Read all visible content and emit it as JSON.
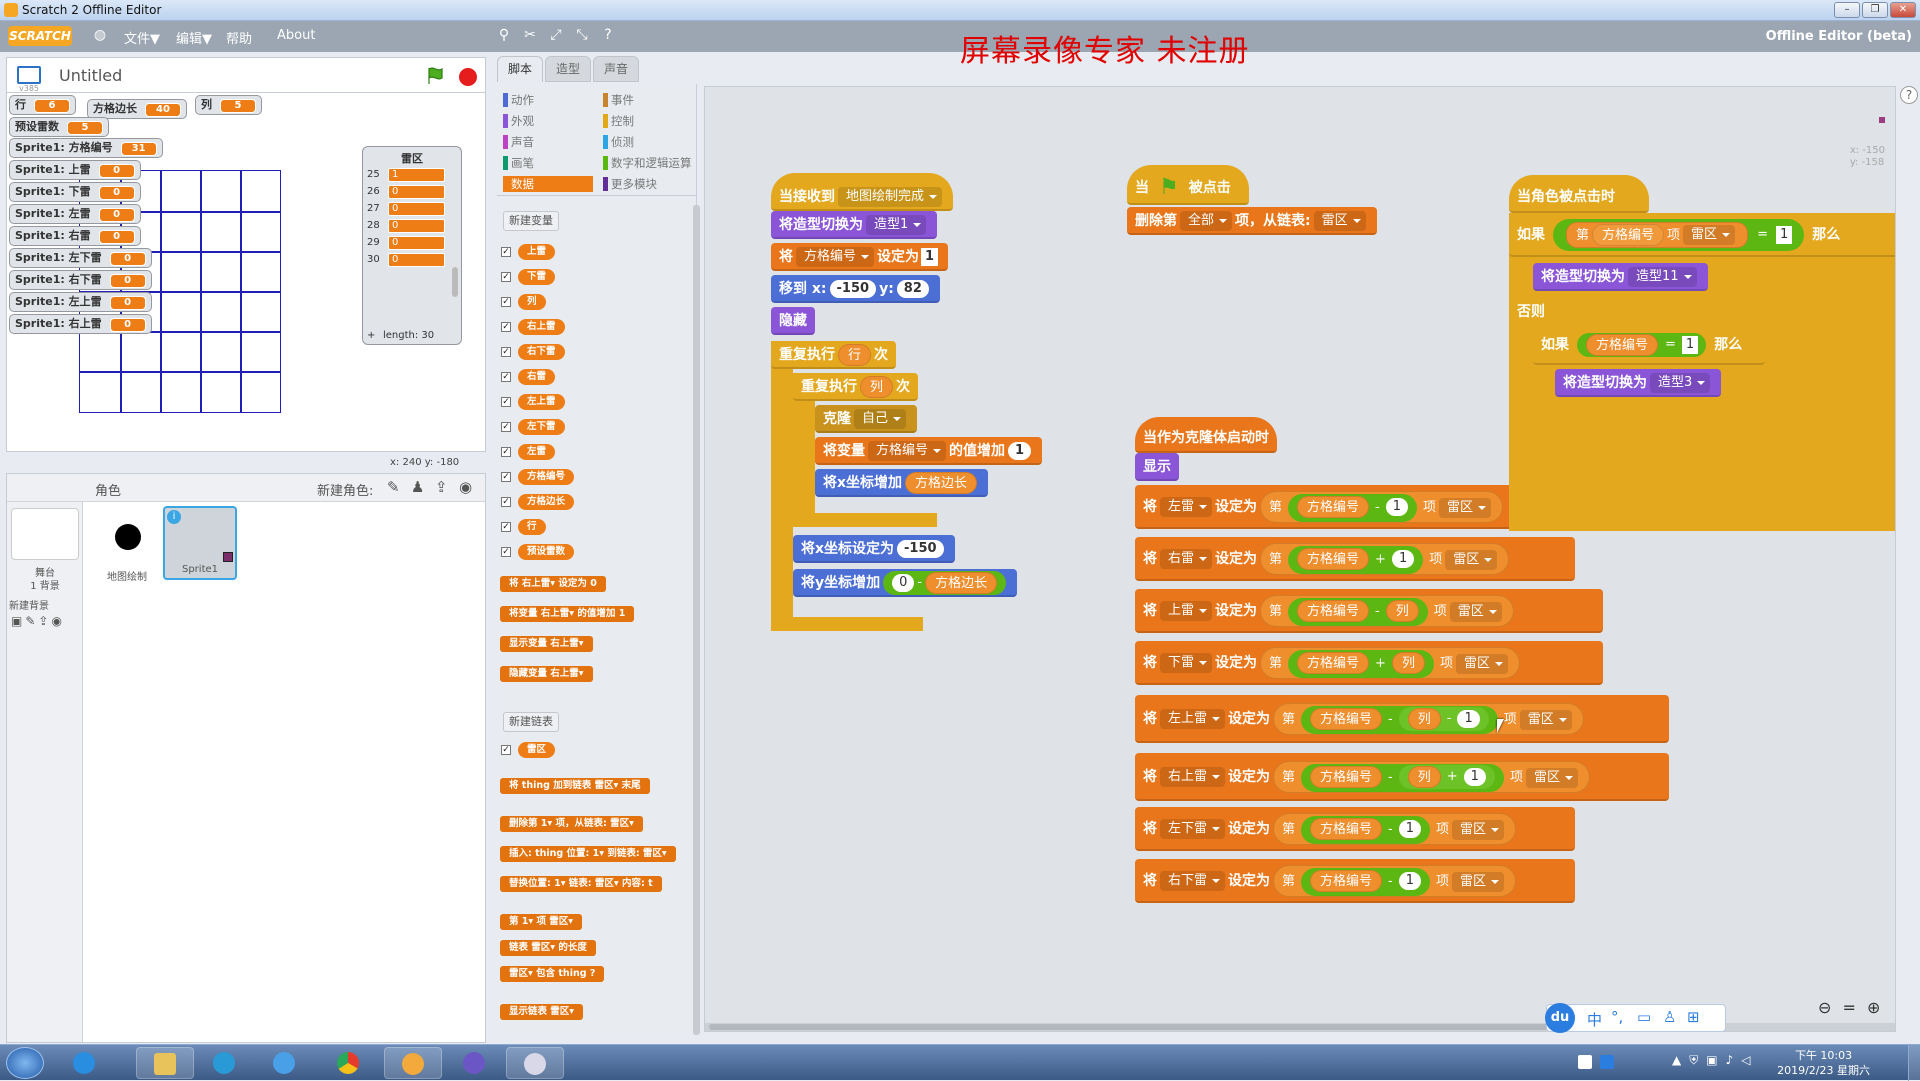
{
  "window": {
    "title": "Scratch 2 Offline Editor"
  },
  "menu": {
    "logo": "SCRATCH",
    "file": "文件▼",
    "edit": "编辑▼",
    "help": "帮助",
    "about": "About",
    "edition": "Offline Editor (beta)"
  },
  "watermark": "屏幕录像专家  未注册",
  "stage": {
    "project_title": "Untitled",
    "version": "v385",
    "coords": "x: 240   y: -180"
  },
  "monitors": [
    {
      "label": "行",
      "value": "6"
    },
    {
      "label": "方格边长",
      "value": "40"
    },
    {
      "label": "列",
      "value": "5"
    },
    {
      "label": "预设雷数",
      "value": "5"
    },
    {
      "label": "Sprite1: 方格编号",
      "value": "31"
    },
    {
      "label": "Sprite1: 上雷",
      "value": "0"
    },
    {
      "label": "Sprite1: 下雷",
      "value": "0"
    },
    {
      "label": "Sprite1: 左雷",
      "value": "0"
    },
    {
      "label": "Sprite1: 右雷",
      "value": "0"
    },
    {
      "label": "Sprite1: 左下雷",
      "value": "0"
    },
    {
      "label": "Sprite1: 右下雷",
      "value": "0"
    },
    {
      "label": "Sprite1: 左上雷",
      "value": "0"
    },
    {
      "label": "Sprite1: 右上雷",
      "value": "0"
    }
  ],
  "list_monitor": {
    "title": "雷区",
    "rows": [
      {
        "i": "25",
        "v": "1"
      },
      {
        "i": "26",
        "v": "0"
      },
      {
        "i": "27",
        "v": "0"
      },
      {
        "i": "28",
        "v": "0"
      },
      {
        "i": "29",
        "v": "0"
      },
      {
        "i": "30",
        "v": "0"
      }
    ],
    "length": "length: 30",
    "add": "+"
  },
  "sprites": {
    "header": "角色",
    "new_sprite": "新建角色:",
    "stage_label": "舞台",
    "stage_sub": "1 背景",
    "new_backdrop": "新建背景",
    "items": [
      {
        "name": "地图绘制"
      },
      {
        "name": "Sprite1"
      }
    ]
  },
  "tabs": [
    "脚本",
    "造型",
    "声音"
  ],
  "categories": {
    "left": [
      {
        "label": "动作",
        "color": "#4a6cd4"
      },
      {
        "label": "外观",
        "color": "#8a55d7"
      },
      {
        "label": "声音",
        "color": "#bb42c3"
      },
      {
        "label": "画笔",
        "color": "#0e9a6c"
      },
      {
        "label": "数据",
        "color": "#ee7d16"
      }
    ],
    "right": [
      {
        "label": "事件",
        "color": "#c88330"
      },
      {
        "label": "控制",
        "color": "#e1a91a"
      },
      {
        "label": "侦测",
        "color": "#2ca5e2"
      },
      {
        "label": "数字和逻辑运算",
        "color": "#5cb712"
      },
      {
        "label": "更多模块",
        "color": "#632d99"
      }
    ]
  },
  "palette": {
    "new_var": "新建变量",
    "new_list": "新建链表",
    "vars": [
      "上雷",
      "下雷",
      "列",
      "右上雷",
      "右下雷",
      "右雷",
      "左上雷",
      "左下雷",
      "左雷",
      "方格编号",
      "方格边长",
      "行",
      "预设雷数"
    ],
    "var_blocks": [
      "将 右上雷▾ 设定为 0",
      "将变量 右上雷▾ 的值增加 1",
      "显示变量 右上雷▾",
      "隐藏变量 右上雷▾"
    ],
    "list": "雷区",
    "list_blocks": [
      "将 thing 加到链表 雷区▾ 末尾",
      "删除第 1▾ 项，从链表: 雷区▾",
      "插入: thing 位置: 1▾ 到链表: 雷区▾",
      "替换位置: 1▾ 链表: 雷区▾ 内容: t",
      "第 1▾ 项 雷区▾",
      "链表 雷区▾ 的长度",
      "雷区▾ 包含 thing ?",
      "显示链表 雷区▾"
    ]
  },
  "scripts": {
    "s1": {
      "hat": "当接收到",
      "msg": "地图绘制完成",
      "switch": "将造型切换为",
      "costume": "造型1",
      "set": "将",
      "setvar": "方格编号",
      "setto": "设定为",
      "setval": "1",
      "goto": "移到 x:",
      "gx": "-150",
      "gy_l": "y:",
      "gy": "82",
      "hide": "隐藏",
      "rep1": "重复执行",
      "rep1v": "行",
      "rep_t": "次",
      "rep2v": "列",
      "clone": "克隆",
      "cloneof": "自己",
      "chg": "将变量",
      "chgvar": "方格编号",
      "chgby": "的值增加",
      "chgval": "1",
      "chx": "将x坐标增加",
      "chxv": "方格边长",
      "setx": "将x坐标设定为",
      "setxv": "-150",
      "chy": "将y坐标增加",
      "chyv0": "0",
      "minus": "-",
      "chyv": "方格边长"
    },
    "s2": {
      "hat_when": "当",
      "hat_clicked": "被点击",
      "del": "删除第",
      "delwhich": "全部",
      "delof": "项，从链表:",
      "dellist": "雷区"
    },
    "s3": {
      "hat": "当作为克隆体启动时",
      "show": "显示",
      "set": "将",
      "setto": "设定为",
      "item": "第",
      "itemof": "项",
      "list": "雷区",
      "var": "方格编号",
      "col": "列",
      "one": "1",
      "rows": [
        {
          "v": "左雷",
          "op": "-",
          "t": "1"
        },
        {
          "v": "右雷",
          "op": "+",
          "t": "1"
        },
        {
          "v": "上雷",
          "op": "-",
          "t": "列"
        },
        {
          "v": "下雷",
          "op": "+",
          "t": "列"
        },
        {
          "v": "左上雷",
          "op": "-",
          "t": "列-1"
        },
        {
          "v": "右上雷",
          "op": "-",
          "t": "列+1"
        },
        {
          "v": "左下雷",
          "op": "-",
          "t": "1"
        },
        {
          "v": "右下雷",
          "op": "-",
          "t": "1"
        }
      ]
    },
    "s4": {
      "hat": "当角色被点击时",
      "if": "如果",
      "item": "第",
      "var": "方格编号",
      "itemof": "项",
      "list": "雷区",
      "eq": "=",
      "one": "1",
      "then": "那么",
      "switch": "将造型切换为",
      "c11": "造型11",
      "else": "否则",
      "c3": "造型3"
    }
  },
  "canvas_coords": "x: -150\ny: -158",
  "taskbar": {
    "time": "下午 10:03",
    "date": "2019/2/23 星期六"
  },
  "ime": {
    "du": "du",
    "zh": "中"
  }
}
